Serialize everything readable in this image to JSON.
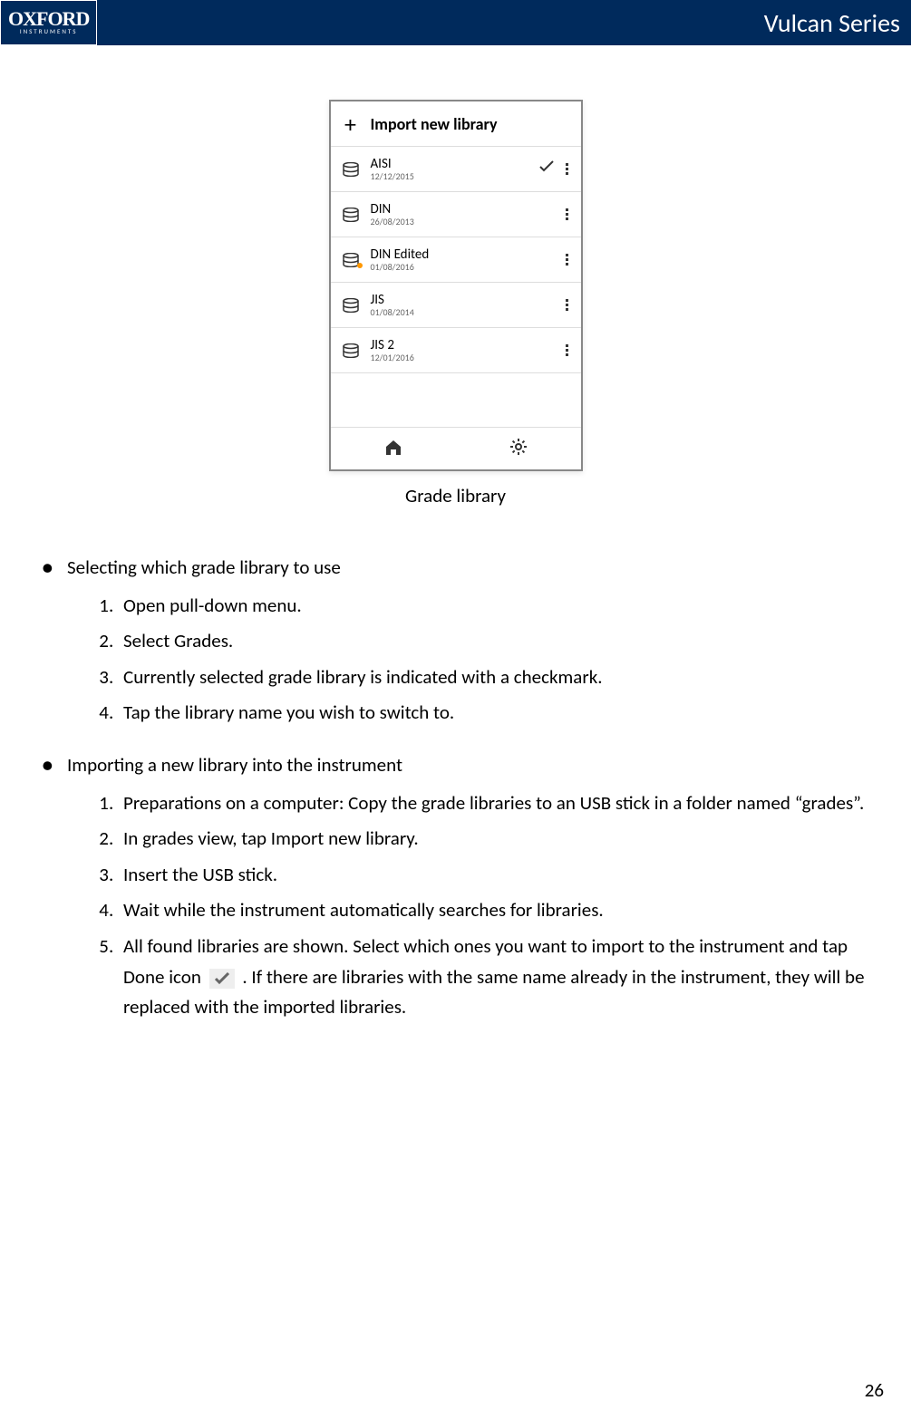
{
  "header": {
    "logo_main": "OXFORD",
    "logo_sub": "INSTRUMENTS",
    "title": "Vulcan Series"
  },
  "screenshot": {
    "import_label": "Import new library",
    "libraries": [
      {
        "name": "AISI",
        "date": "12/12/2015",
        "checked": true,
        "edited": false
      },
      {
        "name": "DIN",
        "date": "26/08/2013",
        "checked": false,
        "edited": false
      },
      {
        "name": "DIN Edited",
        "date": "01/08/2016",
        "checked": false,
        "edited": true
      },
      {
        "name": "JIS",
        "date": "01/08/2014",
        "checked": false,
        "edited": false
      },
      {
        "name": "JIS 2",
        "date": "12/01/2016",
        "checked": false,
        "edited": false
      }
    ],
    "caption": "Grade library"
  },
  "content": {
    "sections": [
      {
        "title": "Selecting which grade library to use",
        "steps": [
          "Open pull-down menu.",
          "Select Grades.",
          "Currently selected grade library is indicated with a checkmark.",
          "Tap the library name you wish to switch to."
        ]
      },
      {
        "title": "Importing a new library into the instrument",
        "steps": [
          "Preparations on a computer: Copy the grade libraries to an USB stick in a folder named “grades”.",
          "In grades view, tap Import new library.",
          "Insert the USB stick.",
          "Wait while the instrument automatically searches for libraries."
        ],
        "step5_a": "All found libraries are shown. Select which ones you want to import to the instrument and tap Done icon ",
        "step5_b": " . If there are libraries with the same name already in the instrument, they will be replaced with the imported libraries."
      }
    ]
  },
  "page_number": "26"
}
